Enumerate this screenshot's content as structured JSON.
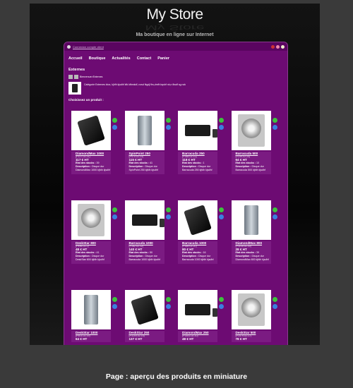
{
  "store": {
    "title": "My Store",
    "tagline": "Ma boutique en ligne sur Internet",
    "login_link": "Connexion compte client"
  },
  "nav": [
    "Accueil",
    "Boutique",
    "Actualités",
    "Contact",
    "Panier"
  ],
  "section_title": "Externes",
  "breadcrumb": "Bienvenue>Externes",
  "category_description": "Catégorie Externes ktox, kjhfh kjsdhf kfk kfbmkdf, nzsd fkgdj fhs,dmfh kqshf nk,n fksdf sg nzk",
  "choose_label": "Choisissez un produit :",
  "labels": {
    "stock": "Etat des stocks :",
    "description": "Description :"
  },
  "products": [
    {
      "name": "DiamondMax 1000",
      "ref": "(P127-02-21)",
      "price": "117 € HT",
      "stock": "39",
      "description": "Disque dur DiamondMax 1000 kjfdh kjsdhf",
      "visual": "external-hdd"
    },
    {
      "name": "SpinPoint 250",
      "ref": "(P470-02-23)",
      "price": "115 € HT",
      "stock": "41",
      "description": "Disque dur SpinPoint 250 kjfdh kjsdhf",
      "visual": "tower"
    },
    {
      "name": "Barracuda 250",
      "ref": "(P348-02-13)",
      "price": "118 € HT",
      "stock": "1",
      "description": "Disque dur Barracuda 250 kjfdh kjsdhf",
      "visual": "media-box"
    },
    {
      "name": "Barracuda 500",
      "ref": "(P239-02-24)",
      "price": "64 € HT",
      "stock": "10",
      "description": "Disque dur Barracuda 500 kjfdh kjsdhf",
      "visual": "internal-hdd"
    },
    {
      "name": "DeskStar 800",
      "ref": "(P496-02-2)",
      "price": "48 € HT",
      "stock": "41",
      "description": "Disque dur DeskStar 800 kjfdh kjsdhf",
      "visual": "internal-hdd"
    },
    {
      "name": "Barracuda 1000",
      "ref": "(P182-02-12)",
      "price": "140 € HT",
      "stock": "50",
      "description": "Disque dur Barracuda 1000 kjfdh kjsdhf",
      "visual": "media-box"
    },
    {
      "name": "Barracuda 1000",
      "ref": "(P389-02-20)",
      "price": "80 € HT",
      "stock": "16",
      "description": "Disque dur Barracuda 1000 kjfdh kjsdhf",
      "visual": "external-hdd"
    },
    {
      "name": "DiamondMax 800",
      "ref": "(P1105-02-30)",
      "price": "28 € HT",
      "stock": "39",
      "description": "Disque dur DiamondMax 800 kjfdh kjsdhf",
      "visual": "tower"
    },
    {
      "name": "DeskStar 1000",
      "ref": "(P601-02-19)",
      "price": "64 € HT",
      "visual": "tower"
    },
    {
      "name": "DeskStar 250",
      "ref": "(P1149-02-16)",
      "price": "137 € HT",
      "visual": "external-hdd"
    },
    {
      "name": "DiamondMax 250",
      "ref": "(P1451-02-10)",
      "price": "48 € HT",
      "visual": "media-box"
    },
    {
      "name": "DeskStar 500",
      "ref": "(P1479-02-17)",
      "price": "78 € HT",
      "visual": "internal-hdd"
    }
  ],
  "colors": {
    "site_background": "#6d0b73",
    "card_panel": "#7b1b82",
    "icon_green": "#3cc43c",
    "icon_blue": "#3b7fe0"
  },
  "caption": "Page : aperçu des produits en miniature"
}
